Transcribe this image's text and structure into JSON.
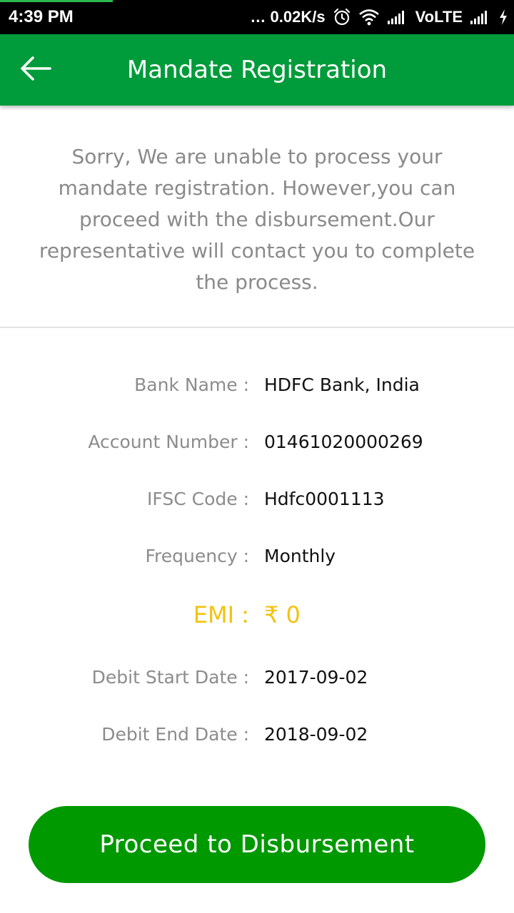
{
  "status_bar": {
    "time": "4:39 PM",
    "network_speed": "… 0.02K/s",
    "network_type": "VoLTE",
    "icons": [
      "alarm-icon",
      "wifi-icon",
      "signal-icon",
      "signal-icon",
      "charging-icon"
    ]
  },
  "header": {
    "title": "Mandate Registration",
    "back_icon": "arrow-left-icon",
    "background_color": "#009b3a"
  },
  "message": "Sorry, We are unable to process your mandate registration. However,you can proceed with the disbursement.Our representative will contact you to complete the process.",
  "details": [
    {
      "label": "Bank Name :",
      "value": "HDFC Bank, India"
    },
    {
      "label": "Account Number :",
      "value": "01461020000269"
    },
    {
      "label": "IFSC Code :",
      "value": "Hdfc0001113"
    },
    {
      "label": "Frequency :",
      "value": "Monthly"
    },
    {
      "label": "EMI :",
      "value": "₹ 0",
      "highlight_color": "#f4c20d"
    },
    {
      "label": "Debit Start Date :",
      "value": "2017-09-02"
    },
    {
      "label": "Debit End Date :",
      "value": "2018-09-02"
    }
  ],
  "proceed_button": {
    "label": "Proceed to Disbursement",
    "color": "#009900"
  }
}
